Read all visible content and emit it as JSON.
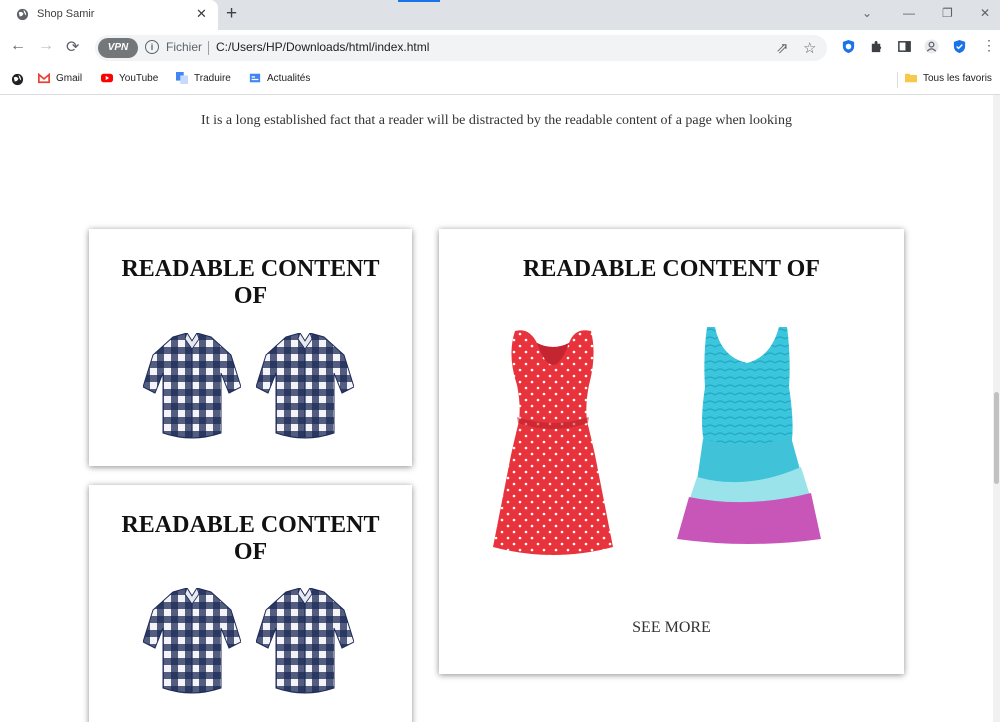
{
  "browser": {
    "tab_title": "Shop Samir",
    "vpn_label": "VPN",
    "scheme_label": "Fichier",
    "url": "C:/Users/HP/Downloads/html/index.html",
    "bookmarks": [
      "Gmail",
      "YouTube",
      "Traduire",
      "Actualités"
    ],
    "all_bookmarks": "Tous les favoris"
  },
  "page": {
    "intro": "It is a long established fact that a reader will be distracted by the readable content of a page when looking",
    "cards": [
      {
        "title": "READABLE CONTENT OF",
        "images": [
          "plaid-shirt",
          "plaid-shirt"
        ]
      },
      {
        "title": "READABLE CONTENT OF",
        "images": [
          "plaid-shirt",
          "plaid-shirt"
        ]
      },
      {
        "title": "READABLE CONTENT OF",
        "images": [
          "red-polka-dot-dress",
          "turquoise-pink-tiered-dress"
        ],
        "button": "SEE MORE"
      }
    ]
  },
  "colors": {
    "dress_red": "#e8333d",
    "dress_turquoise": "#3cc6dd",
    "dress_pink": "#c855b8",
    "plaid_navy": "#1c2a57"
  }
}
